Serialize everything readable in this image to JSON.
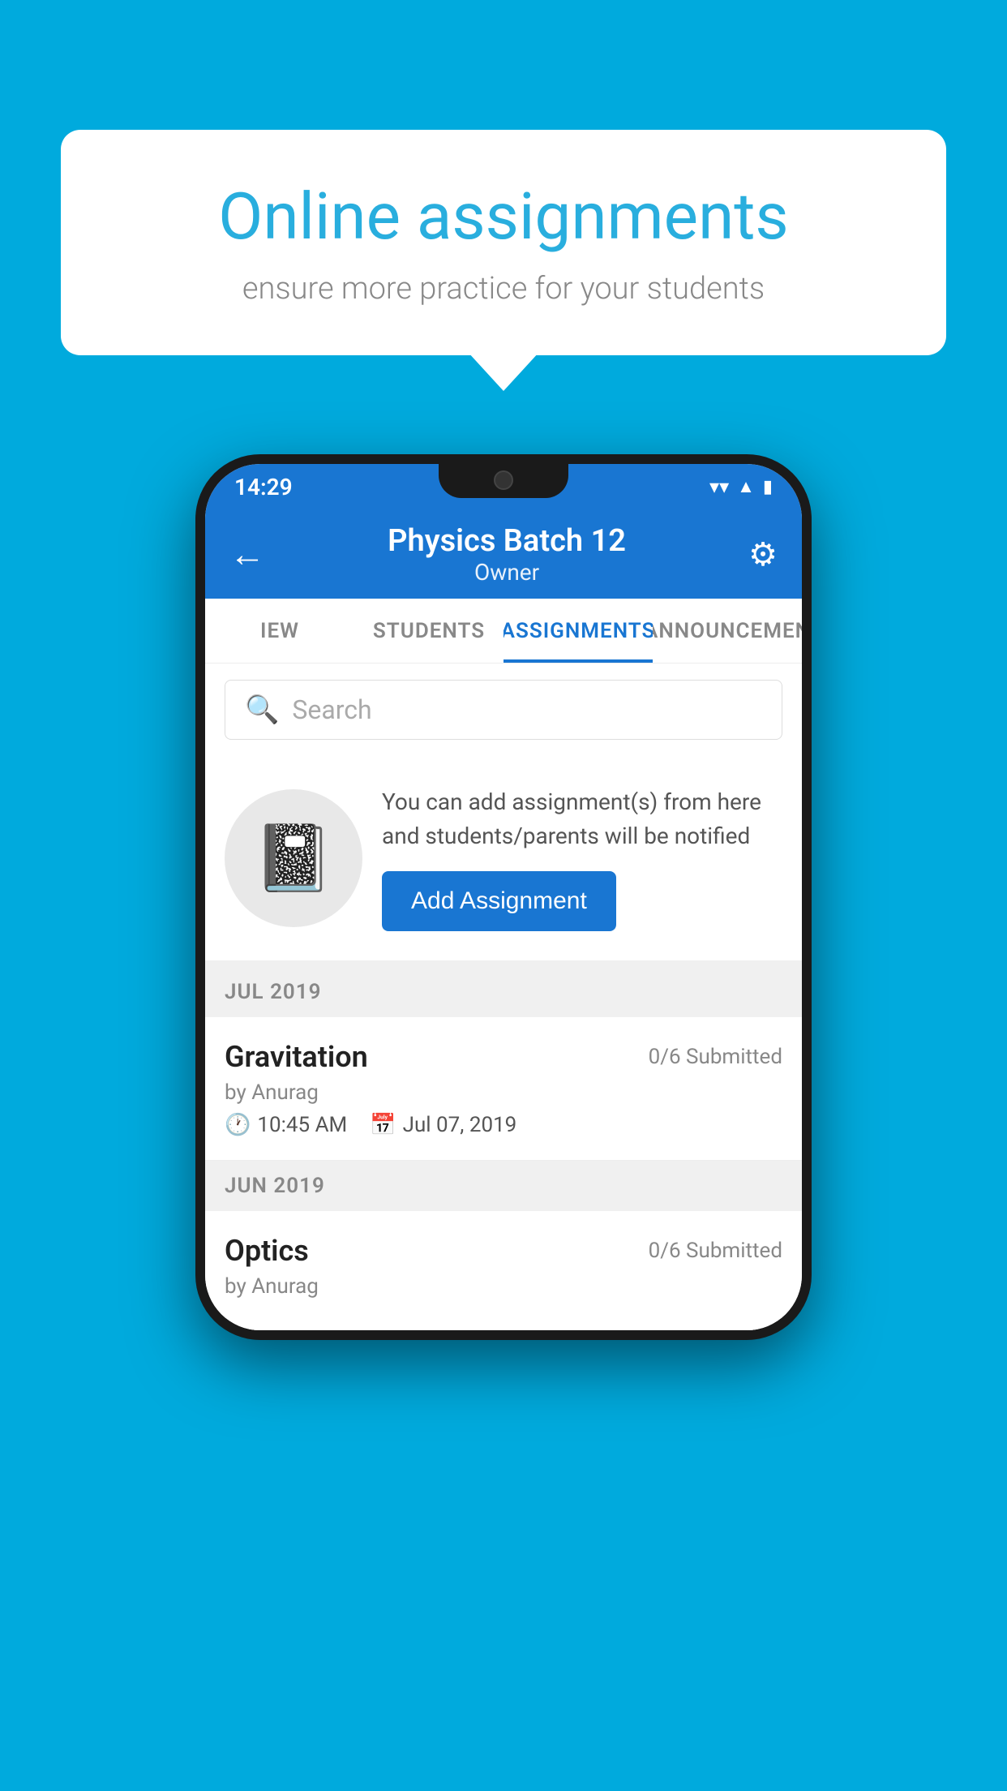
{
  "background_color": "#00AADD",
  "speech_bubble": {
    "title": "Online assignments",
    "subtitle": "ensure more practice for your students"
  },
  "status_bar": {
    "time": "14:29",
    "wifi_icon": "▼",
    "signal_icon": "◀",
    "battery_icon": "▮"
  },
  "app_bar": {
    "back_label": "←",
    "title": "Physics Batch 12",
    "subtitle": "Owner",
    "settings_icon": "⚙"
  },
  "tabs": [
    {
      "label": "IEW",
      "active": false
    },
    {
      "label": "STUDENTS",
      "active": false
    },
    {
      "label": "ASSIGNMENTS",
      "active": true
    },
    {
      "label": "ANNOUNCEMEN",
      "active": false
    }
  ],
  "search": {
    "placeholder": "Search",
    "icon": "🔍"
  },
  "promo": {
    "icon": "📓",
    "text": "You can add assignment(s) from here and students/parents will be notified",
    "button_label": "Add Assignment"
  },
  "sections": [
    {
      "header": "JUL 2019",
      "assignments": [
        {
          "title": "Gravitation",
          "submitted": "0/6 Submitted",
          "by": "by Anurag",
          "time": "10:45 AM",
          "date": "Jul 07, 2019"
        }
      ]
    },
    {
      "header": "JUN 2019",
      "assignments": [
        {
          "title": "Optics",
          "submitted": "0/6 Submitted",
          "by": "by Anurag",
          "time": "",
          "date": ""
        }
      ]
    }
  ]
}
